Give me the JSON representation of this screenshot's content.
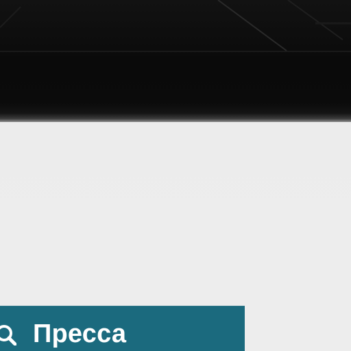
{
  "press_button": {
    "label": "Пресса",
    "icon": "magnifier-icon",
    "color": "#1b6a7e"
  },
  "theme": {
    "ceiling": "#0c0c0c",
    "wall": "#ececec"
  }
}
